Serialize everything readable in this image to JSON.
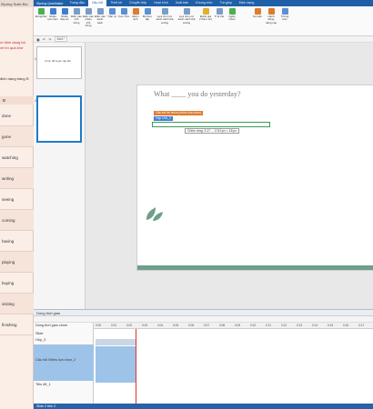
{
  "left_panel": {
    "top": "iSpring Suite Bio",
    "notes": [
      "ời định dạng bả",
      "về thì quá khứ",
      "định dạng bảng Đ"
    ],
    "column_header": "Đ",
    "rows": [
      "done",
      "gone",
      "watching",
      "writing",
      "seeing",
      "coming",
      "having",
      "playing",
      "buying",
      "visiting",
      "finishing"
    ]
  },
  "app": {
    "title": "iSpring QuizMaker",
    "tabs": [
      "Trang đầu",
      "Câu hỏi",
      "Thiết kế",
      "Chuyển tiếp",
      "Hoạt hình",
      "Xuất bản",
      "Khung nhìn",
      "Trợ giúp",
      "Định dạng"
    ],
    "active_tab": "Câu hỏi",
    "ribbon_buttons": [
      "Đúng/Sai",
      "Nhiều lựa chọn",
      "Nhiều đáp án",
      "Điền vào chỗ trống",
      "Điền vào nhiều chỗ trống",
      "Điền vào danh sách",
      "Trận tự",
      "Kéo Thả",
      "Điểm ảnh",
      "Bộ Sưu tập",
      "Lựa chọn từ danh sách thả xuống",
      "Lựa chọn từ danh sách thả xuống",
      "Đánh giá (Thêm số)",
      "Tỉ lệ thẻ",
      "Ngẫu nhiên",
      "Sự kiện",
      "Hành động nâng cao",
      "Thông báo"
    ],
    "slide_tab": "Bài1*",
    "slide_title": "What ____ you do yesterday?",
    "labels": [
      "Câu trả lời chứa (nhiều lựa chọn)",
      "Hộp chữ_3"
    ],
    "tooltip": "Chiều rộng: 3.17 ... 1743 px × 18 px",
    "thumb_title": "Chúc đề luyện tập Đề",
    "thumb_nums": [
      "1",
      "2"
    ],
    "timeline": {
      "title": "Dòng thời gian",
      "rows": [
        "Dòng thời gian chính",
        "Slide",
        "Hộp_3",
        "Câu hỏi Nhiều lựa chọn_2",
        "Tiêu đề_1"
      ],
      "ticks": [
        "0:00",
        "0:01",
        "0:02",
        "0:03",
        "0:04",
        "0:05",
        "0:06",
        "0:07",
        "0:08",
        "0:09",
        "0:10",
        "0:11",
        "0:12",
        "0:13",
        "0:14",
        "0:15",
        "0:16",
        "0:17"
      ]
    },
    "status": "Slide 2 trên 2"
  },
  "colors": {
    "brand": "#1f5fa8",
    "accent_green": "#6f9e8a",
    "label_orange": "#e07a2c"
  }
}
